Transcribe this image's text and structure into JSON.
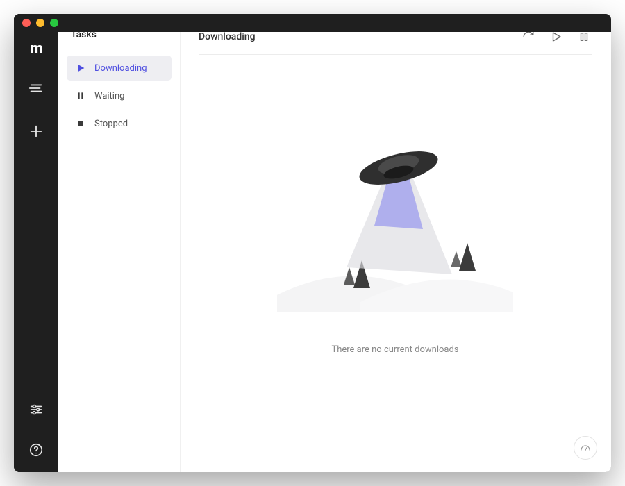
{
  "window": {
    "traffic_lights": [
      "close",
      "minimize",
      "maximize"
    ]
  },
  "rail": {
    "logo_label": "m",
    "items": [
      {
        "name": "tasks-list-icon",
        "label": "Tasks list"
      },
      {
        "name": "add-icon",
        "label": "Add task"
      }
    ],
    "footer": [
      {
        "name": "settings-icon",
        "label": "Settings"
      },
      {
        "name": "help-icon",
        "label": "Help"
      }
    ]
  },
  "sidebar": {
    "title": "Tasks",
    "items": [
      {
        "icon": "play-icon",
        "label": "Downloading",
        "active": true
      },
      {
        "icon": "pause-icon",
        "label": "Waiting",
        "active": false
      },
      {
        "icon": "stop-icon",
        "label": "Stopped",
        "active": false
      }
    ]
  },
  "main": {
    "title": "Downloading",
    "actions": [
      {
        "name": "refresh-icon",
        "label": "Refresh"
      },
      {
        "name": "resume-icon",
        "label": "Resume"
      },
      {
        "name": "pause-all-icon",
        "label": "Pause all"
      }
    ],
    "empty_message": "There are no current downloads"
  },
  "colors": {
    "accent": "#4f4fe0",
    "rail_bg": "#1f1f1f"
  }
}
